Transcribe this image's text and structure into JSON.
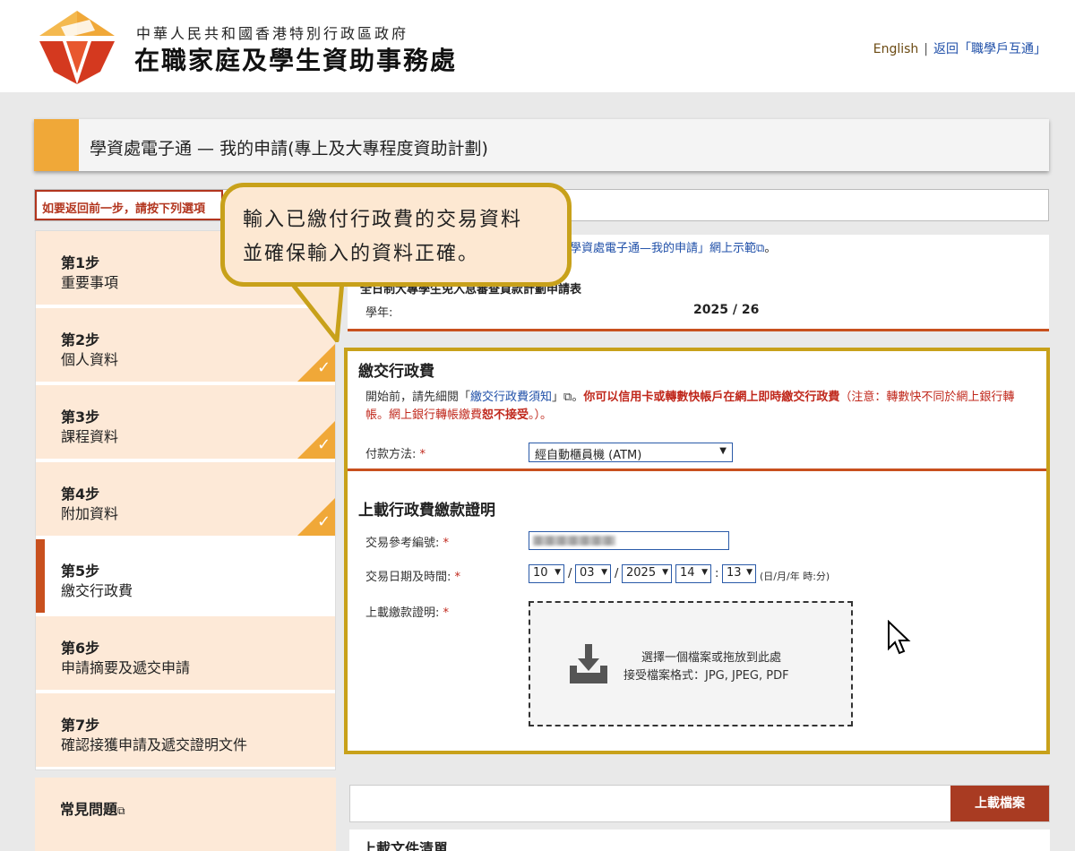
{
  "header": {
    "org_sub": "中華人民共和國香港特別行政區政府",
    "org_main": "在職家庭及學生資助事務處",
    "english_link": "English",
    "separator": "|",
    "back_link": "返回「職學戶互通」"
  },
  "page": {
    "title": "學資處電子通 — 我的申請(專上及大專程度資助計劃)",
    "notice": "如要返回前一步，請按下列選項",
    "demo_link": "學資處電子通—我的申請」網上示範",
    "demo_tail": "。",
    "form_title": "全日制大專學生免入息審查貸款計劃申請表",
    "year_label": "學年:",
    "year_value": "2025 / 26"
  },
  "steps": [
    {
      "num": "第1步",
      "name": "重要事項",
      "done": false
    },
    {
      "num": "第2步",
      "name": "個人資料",
      "done": true
    },
    {
      "num": "第3步",
      "name": "課程資料",
      "done": true
    },
    {
      "num": "第4步",
      "name": "附加資料",
      "done": true
    },
    {
      "num": "第5步",
      "name": "繳交行政費",
      "done": false,
      "active": true
    },
    {
      "num": "第6步",
      "name": "申請摘要及遞交申請",
      "done": false
    },
    {
      "num": "第7步",
      "name": "確認接獲申請及遞交證明文件",
      "done": false
    }
  ],
  "faq": "常見問題",
  "check_glyph": "✓",
  "ext_glyph": "⧉",
  "payment": {
    "heading": "繳交行政費",
    "intro_a": "開始前，請先細閱「",
    "intro_link": "繳交行政費須知",
    "intro_b": "」⧉。",
    "intro_red": "你可以信用卡或轉數快帳戶在網上即時繳交行政費",
    "intro_note": "（注意：轉數快不同於網上銀行轉帳。網上銀行轉帳繳費",
    "intro_red2": "恕不接受",
    "intro_end": "。）。",
    "method_label": "付款方法:",
    "required": "*",
    "method_value": "經自動櫃員機 (ATM)",
    "arrow": "▼"
  },
  "proof": {
    "heading": "上載行政費繳款證明",
    "ref_label": "交易參考編號:",
    "datetime_label": "交易日期及時間:",
    "day": "10",
    "month": "03",
    "year": "2025",
    "hour": "14",
    "minute": "13",
    "slash": "/",
    "colon": ":",
    "format": "(日/月/年 時:分)",
    "upload_label": "上載繳款證明:",
    "drop_line1": "選擇一個檔案或拖放到此處",
    "drop_line2": "接受檔案格式：JPG, JPEG, PDF"
  },
  "upload_button": "上載檔案",
  "doc_list_title": "上載文件清單",
  "callout": {
    "line1": "輸入已繳付行政費的交易資料",
    "line2": "並確保輸入的資料正確。"
  },
  "colors": {
    "accent_orange": "#f0a838",
    "brand_red": "#c8501e",
    "frame_gold": "#c8a11a",
    "button_red": "#a93b22"
  }
}
